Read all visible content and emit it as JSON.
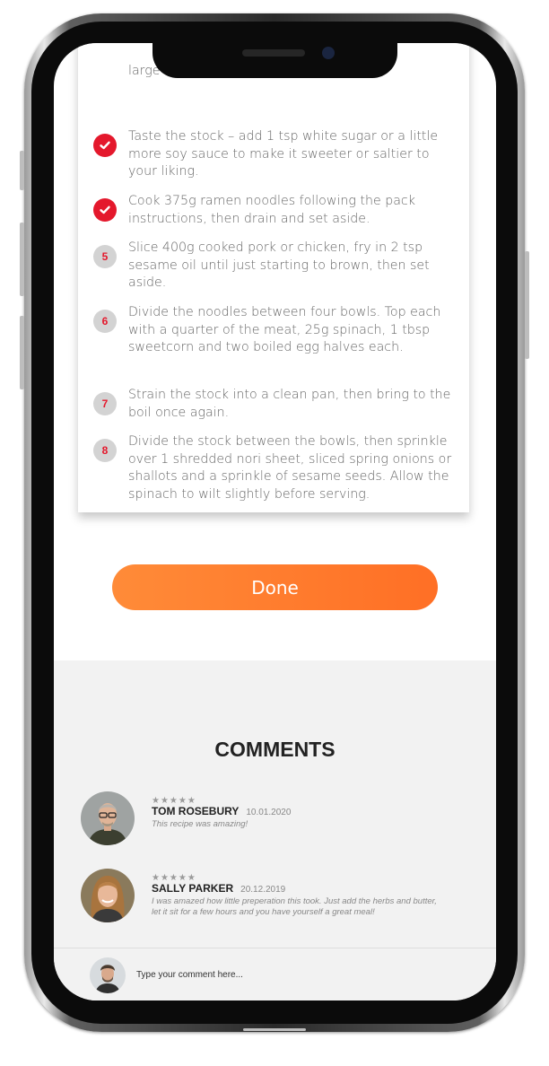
{
  "steps": {
    "partial_top": "large ... reduce ... s.",
    "items": [
      {
        "status": "done",
        "number": "",
        "text": "Taste the stock – add 1 tsp white sugar or a little more soy sauce to make it sweeter or saltier to your liking."
      },
      {
        "status": "done",
        "number": "",
        "text": "Cook 375g ramen noodles following the pack instructions, then drain and set aside."
      },
      {
        "status": "pending",
        "number": "5",
        "text": "Slice 400g cooked pork or chicken, fry in 2 tsp sesame oil until just starting to brown, then set aside."
      },
      {
        "status": "pending",
        "number": "6",
        "text": "Divide the noodles between four bowls. Top each with a quarter of the meat, 25g spinach, 1 tbsp sweetcorn and two boiled egg halves each."
      },
      {
        "status": "pending",
        "number": "7",
        "text": "Strain the stock into a clean pan, then bring to the boil once again."
      },
      {
        "status": "pending",
        "number": "8",
        "text": "Divide the stock between the bowls, then sprinkle over 1 shredded nori sheet, sliced spring onions or shallots and a sprinkle of sesame seeds. Allow the spinach to wilt slightly before serving."
      }
    ]
  },
  "done_button": {
    "label": "Done"
  },
  "comments": {
    "title": "COMMENTS",
    "items": [
      {
        "author": "TOM ROSEBURY",
        "date": "10.01.2020",
        "rating": 4.5,
        "stars": "★★★★★",
        "text": "This recipe was amazing!"
      },
      {
        "author": "SALLY PARKER",
        "date": "20.12.2019",
        "rating": 4.5,
        "stars": "★★★★★",
        "text": "I was amazed how little preperation this took. Just add the herbs and butter, let it sit for a few hours and you have yourself a great meal!"
      }
    ],
    "input": {
      "placeholder": "Type your comment here..."
    }
  },
  "colors": {
    "accent": "#ff7a2e",
    "check_red": "#e4182c",
    "comments_bg": "#f2f2f2"
  }
}
